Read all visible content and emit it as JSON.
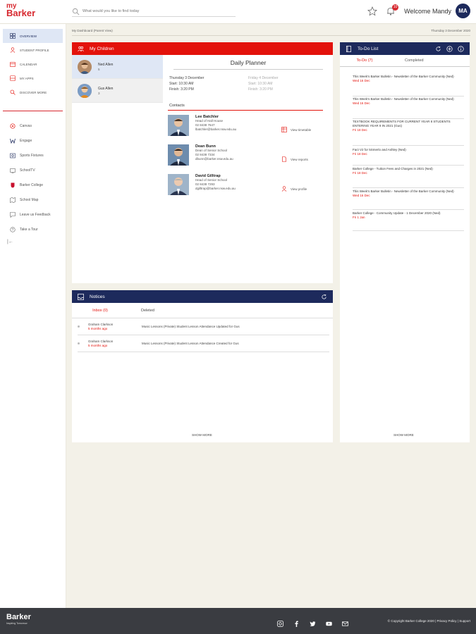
{
  "app": {
    "logo_my": "my",
    "logo_brand": "Barker"
  },
  "search": {
    "placeholder": "What would you like to find today"
  },
  "header": {
    "notification_count": "10",
    "welcome": "Welcome Mandy",
    "avatar_initials": "MA"
  },
  "sidebar": {
    "items": [
      {
        "label": "OVERVIEW",
        "icon": "grid-icon"
      },
      {
        "label": "STUDENT PROFILE",
        "icon": "person-icon"
      },
      {
        "label": "CALENDAR",
        "icon": "calendar-icon"
      },
      {
        "label": "MY APPS",
        "icon": "apps-icon"
      },
      {
        "label": "DISCOVER MORE",
        "icon": "search-icon"
      }
    ],
    "links": [
      {
        "label": "Canvas"
      },
      {
        "label": "Engage"
      },
      {
        "label": "Sports Fixtures"
      },
      {
        "label": "SchoolTV"
      },
      {
        "label": "Barker College"
      },
      {
        "label": "School Map"
      },
      {
        "label": "Leave us Feedback"
      },
      {
        "label": "Take a Tour"
      }
    ],
    "collapse": "|←"
  },
  "breadcrumb": {
    "text": "My Dashboard (Parent View)",
    "date": "Thursday 3 December 2020"
  },
  "children_card": {
    "title": "My Children",
    "children": [
      {
        "name": "Ned Allen",
        "year": "5"
      },
      {
        "name": "Gus Allen",
        "year": "3"
      }
    ]
  },
  "planner": {
    "title": "Daily Planner",
    "today": {
      "day": "Thursday 3 December",
      "start": "Start: 10:30 AM",
      "finish": "Finish: 3:20 PM"
    },
    "tomorrow": {
      "day": "Friday 4 December",
      "start": "Start: 10:30 AM",
      "finish": "Finish: 3:20 PM"
    },
    "contacts_heading": "Contacts",
    "contacts": [
      {
        "name": "Lee Batchler",
        "role": "Head of Hall House",
        "phone": "02 8438 7647",
        "email": "lbatchler@barker.nsw.edu.au"
      },
      {
        "name": "Dean Bunn",
        "role": "Dean of Senior School",
        "phone": "02 8438 7334",
        "email": "dbunn@barker.nsw.edu.au"
      },
      {
        "name": "David Gilltrap",
        "role": "Head of Senior School",
        "phone": "02 8438 7293",
        "email": "dgilltrap@barker.nsw.edu.au"
      }
    ],
    "actions": [
      "View timetable",
      "View reports",
      "View profile"
    ]
  },
  "notices": {
    "title": "Notices",
    "tab_inbox": "Inbox (0)",
    "tab_deleted": "Deleted",
    "rows": [
      {
        "from": "Graham Clarkson",
        "ago": "5 months ago",
        "subject": "Music Lessons (Private) Student Lesson Attendance Updated for Gus"
      },
      {
        "from": "Graham Clarkson",
        "ago": "5 months ago",
        "subject": "Music Lessons (Private) Student Lesson Attendance Created for Gus"
      }
    ],
    "show_more": "SHOW MORE"
  },
  "todo": {
    "title": "To-Do List",
    "tab_todo": "To-Do (7)",
    "tab_completed": "Completed",
    "items": [
      {
        "title": "This Week's Barker Bulletin - Newsletter of the Barker Community (Ned)",
        "due": "Wed 16 Dec"
      },
      {
        "title": "This Week's Barker Bulletin - Newsletter of the Barker Community (Ned)",
        "due": "Wed 16 Dec"
      },
      {
        "title": "TEXTBOOK REQUIREMENTS FOR CURRENT YEAR 8 STUDENTS ENTERING YEAR 9 IN 2021 (Gus)",
        "due": "Fri 18 Dec"
      },
      {
        "title": "Fact V2 for 5Smerlo and Ashley (Ned)",
        "due": "Fri 18 Dec"
      },
      {
        "title": "Barker College - Tuition Fees and Charges in 2021 (Ned)",
        "due": "Fri 18 Dec"
      },
      {
        "title": "This Week's Barker Bulletin - Newsletter of the Barker Community (Ned)",
        "due": "Wed 16 Dec"
      },
      {
        "title": "Barker College - Community Update - 1 December 2020 (Ned)",
        "due": "Fri 1 Jan"
      }
    ],
    "show_more": "SHOW MORE"
  },
  "footer": {
    "brand": "Barker",
    "tagline": "Inspiring Tomorrow",
    "copyright": "© Copyright Barker College 2020  |  Privacy Policy  |  Support"
  },
  "colors": {
    "red": "#e3120b",
    "navy": "#1d2a5c",
    "background": "#f3f1e8"
  }
}
